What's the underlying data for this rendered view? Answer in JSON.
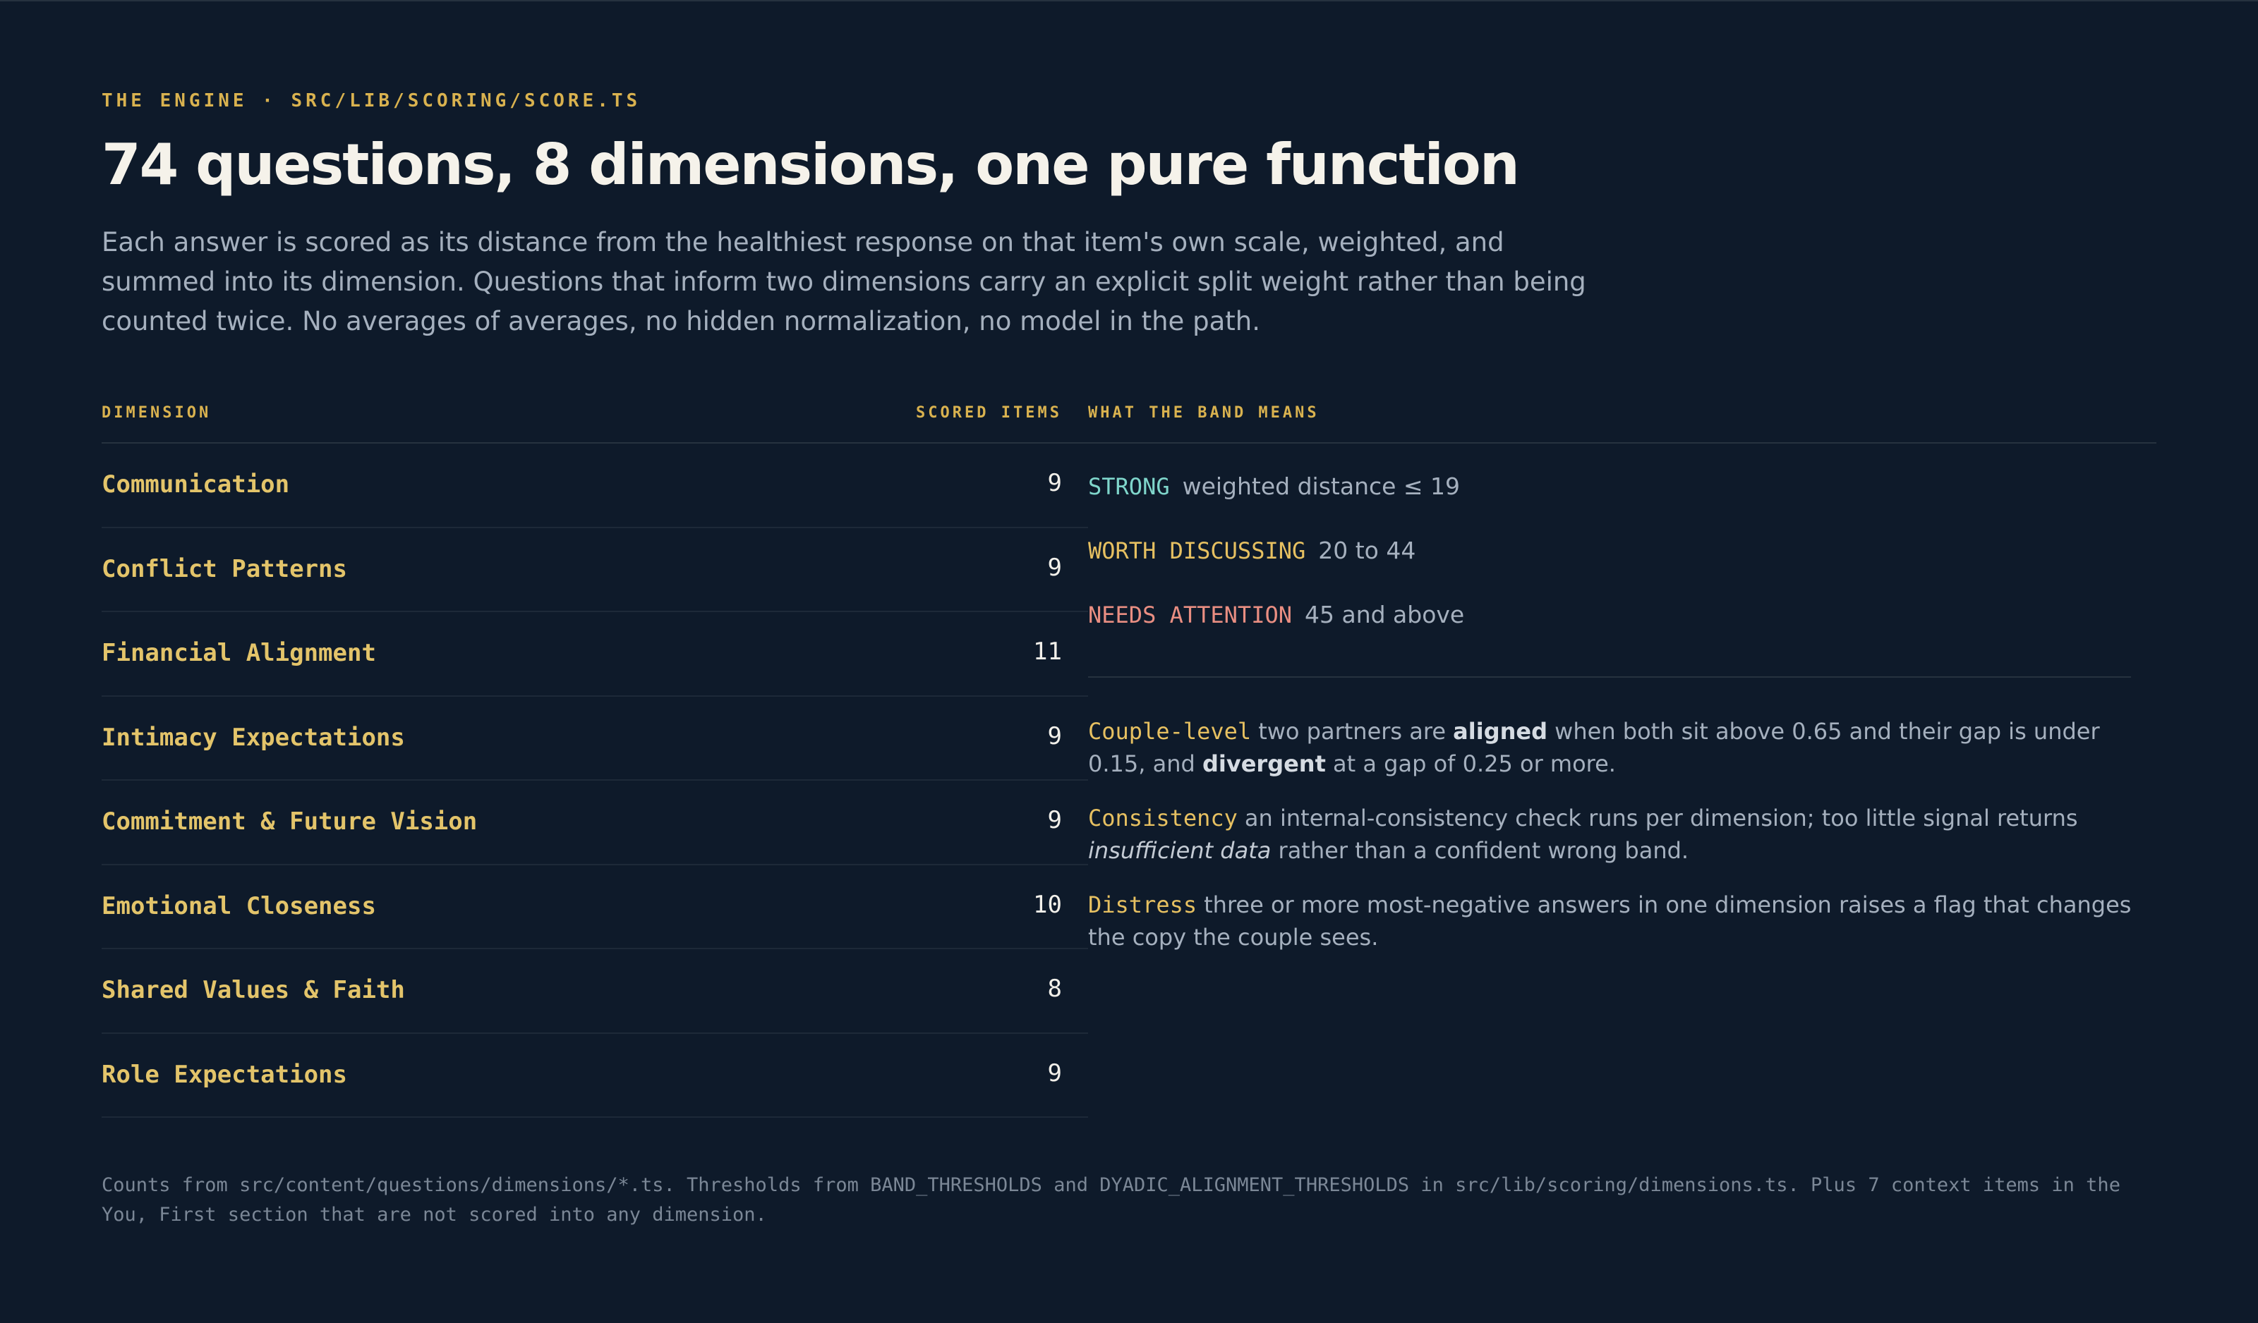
{
  "header": {
    "eyebrow": "THE ENGINE · SRC/LIB/SCORING/SCORE.TS",
    "title": "74 questions, 8 dimensions, one pure function",
    "lede": "Each answer is scored as its distance from the healthiest response on that item's own scale, weighted, and summed into its dimension. Questions that inform two dimensions carry an explicit split weight rather than being counted twice. No averages of averages, no hidden normalization, no model in the path."
  },
  "table": {
    "headers": {
      "dimension": "DIMENSION",
      "scored_items": "SCORED ITEMS",
      "band_meaning": "WHAT THE BAND MEANS"
    },
    "rows": [
      {
        "name": "Communication",
        "count": "9"
      },
      {
        "name": "Conflict Patterns",
        "count": "9"
      },
      {
        "name": "Financial Alignment",
        "count": "11"
      },
      {
        "name": "Intimacy Expectations",
        "count": "9"
      },
      {
        "name": "Commitment & Future Vision",
        "count": "9"
      },
      {
        "name": "Emotional Closeness",
        "count": "10"
      },
      {
        "name": "Shared Values & Faith",
        "count": "8"
      },
      {
        "name": "Role Expectations",
        "count": "9"
      }
    ]
  },
  "bands": [
    {
      "label": "STRONG",
      "desc": "weighted distance ≤ 19",
      "color": "#7fd6cb"
    },
    {
      "label": "WORTH DISCUSSING",
      "desc": "20 to 44",
      "color": "#e6c061"
    },
    {
      "label": "NEEDS ATTENTION",
      "desc": "45 and above",
      "color": "#e98e82"
    }
  ],
  "notes": {
    "couple": {
      "label": "Couple-level",
      "t1": "two partners are",
      "b1": "aligned",
      "t2": "when both sit above 0.65 and their gap is under 0.15, and",
      "b2": "divergent",
      "t3": "at a gap of 0.25 or more."
    },
    "consistency": {
      "label": "Consistency",
      "t1": "an internal-consistency check runs per dimension; too little signal returns",
      "em": "insufficient data",
      "t2": "rather than a confident wrong band."
    },
    "distress": {
      "label": "Distress",
      "t1": "three or more most-negative answers in one dimension raises a flag that changes the copy the couple sees."
    }
  },
  "footnote": "Counts from src/content/questions/dimensions/*.ts. Thresholds from BAND_THRESHOLDS and DYADIC_ALIGNMENT_THRESHOLDS in src/lib/scoring/dimensions.ts. Plus 7 context items in the You, First section that are not scored into any dimension.",
  "colors": {
    "background": "#0e1a2a",
    "accent": "#d9b24f",
    "strong": "#7fd6cb",
    "worth": "#e6c061",
    "attention": "#e98e82"
  }
}
